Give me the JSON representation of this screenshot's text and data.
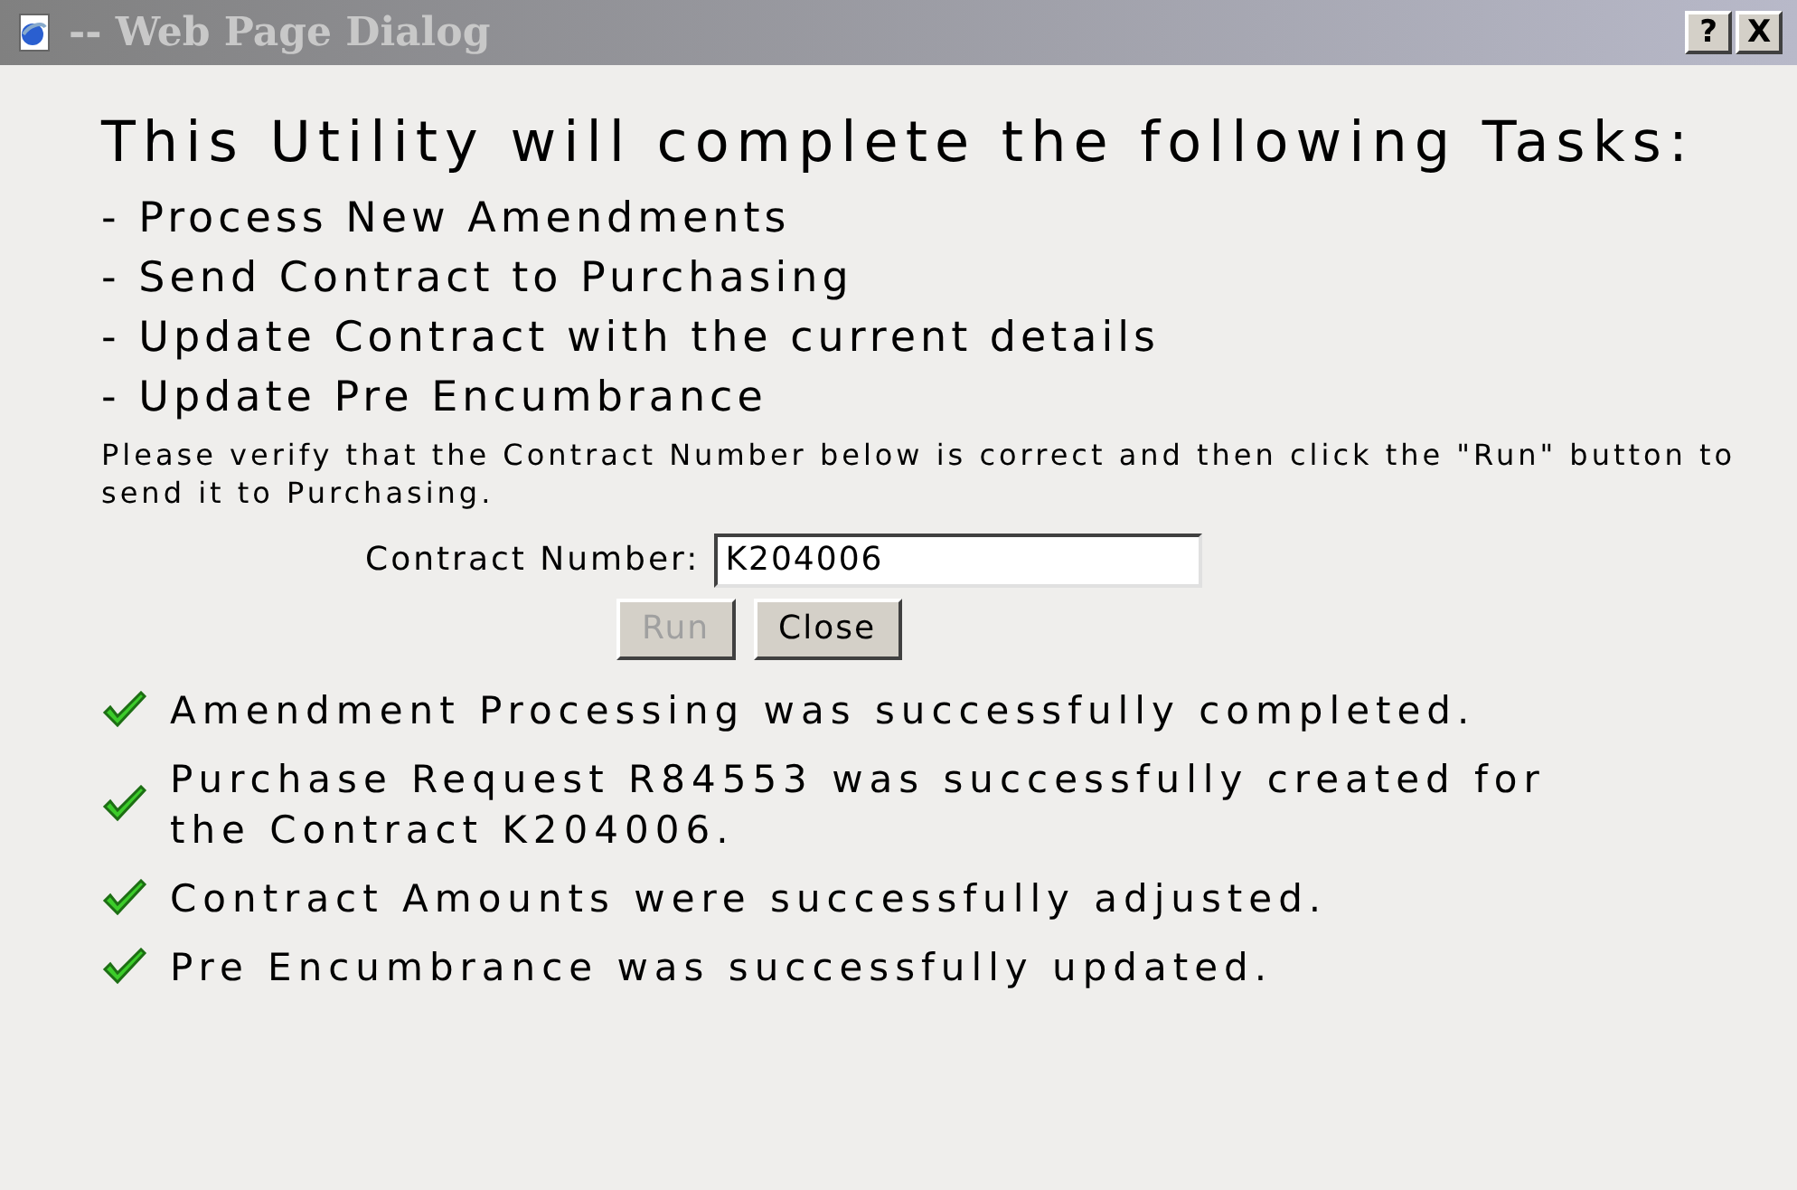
{
  "window": {
    "title": "-- Web Page Dialog",
    "help_button": "?",
    "close_button": "X"
  },
  "heading": "This Utility will complete the following Tasks:",
  "tasks": [
    "- Process New Amendments",
    "- Send Contract to Purchasing",
    "- Update Contract with the current details",
    "- Update Pre Encumbrance"
  ],
  "note": "Please verify that the Contract Number below is correct and then click the \"Run\" button to send it to Purchasing.",
  "contract_field": {
    "label": "Contract Number:",
    "value": "K204006"
  },
  "buttons": [
    {
      "label": "Run",
      "disabled": true
    },
    {
      "label": "Close",
      "disabled": false
    }
  ],
  "results": [
    "Amendment Processing was successfully completed.",
    "Purchase Request R84553 was successfully created for the Contract K204006.",
    "Contract Amounts were successfully adjusted.",
    "Pre Encumbrance was successfully updated."
  ]
}
